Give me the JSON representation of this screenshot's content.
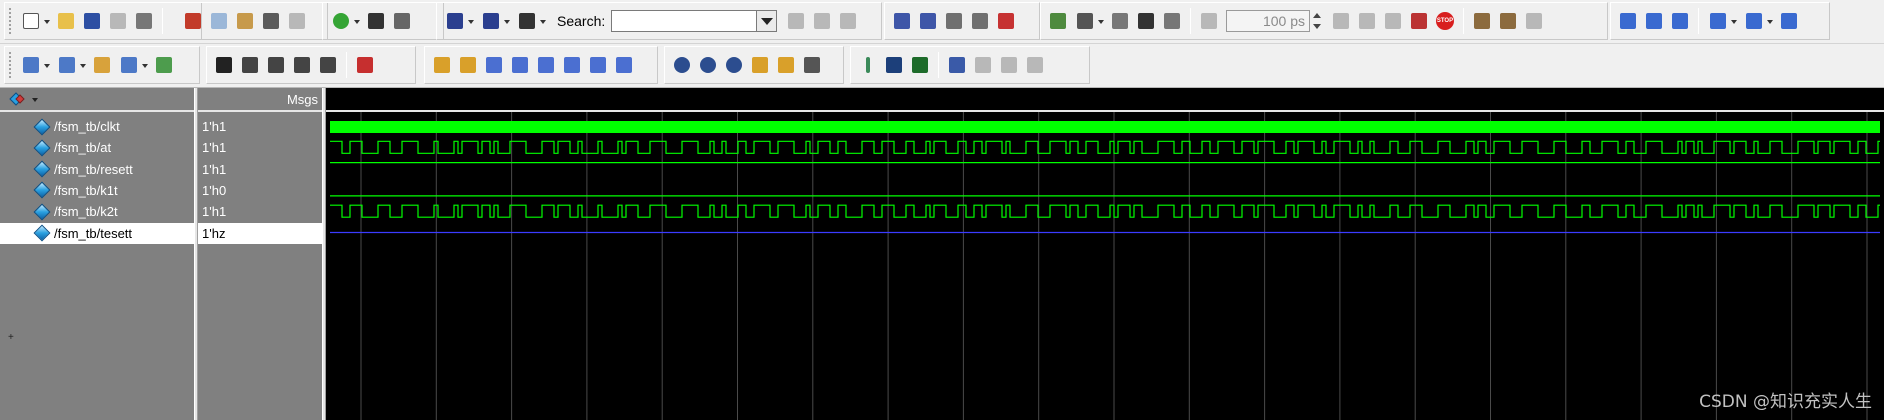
{
  "toolbar": {
    "search_label": "Search:",
    "search_value": "",
    "time_value": "100 ps"
  },
  "wave_window": {
    "names_header_icon": "signal-expand-icon",
    "msgs_header": "Msgs",
    "signals": [
      {
        "name": "/fsm_tb/clkt",
        "value": "1'h1",
        "selected": false
      },
      {
        "name": "/fsm_tb/at",
        "value": "1'h1",
        "selected": false
      },
      {
        "name": "/fsm_tb/resett",
        "value": "1'h1",
        "selected": false
      },
      {
        "name": "/fsm_tb/k1t",
        "value": "1'h0",
        "selected": false
      },
      {
        "name": "/fsm_tb/k2t",
        "value": "1'h1",
        "selected": false
      },
      {
        "name": "/fsm_tb/tesett",
        "value": "1'hz",
        "selected": true
      }
    ],
    "colors": {
      "wave": "#00ff00",
      "hiz": "#3b3bff",
      "grid": "#4a4a4a",
      "panel": "#808080"
    }
  },
  "watermark": "CSDN @知识充实人生"
}
